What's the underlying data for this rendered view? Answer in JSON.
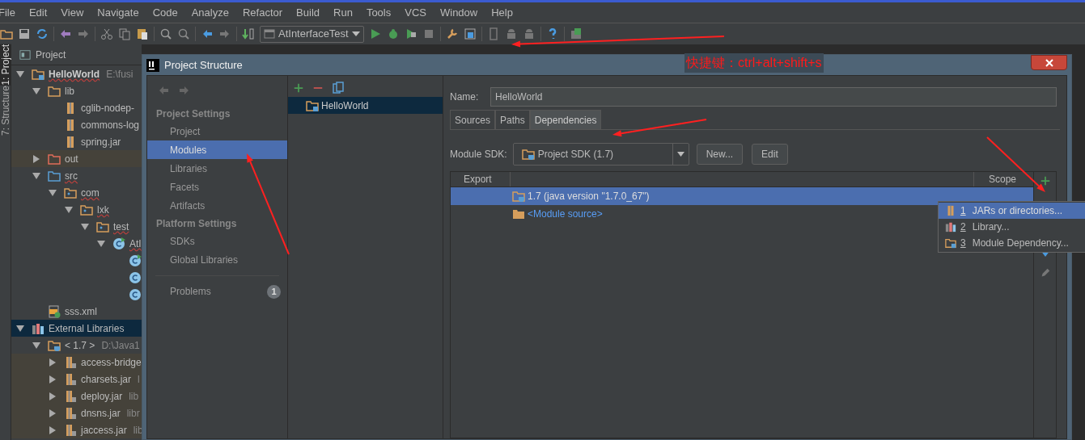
{
  "menu": [
    "File",
    "Edit",
    "View",
    "Navigate",
    "Code",
    "Analyze",
    "Refactor",
    "Build",
    "Run",
    "Tools",
    "VCS",
    "Window",
    "Help"
  ],
  "toolbar": {
    "run_config": "AtInterfaceTest"
  },
  "side_tabs": [
    {
      "label": "1: Project",
      "selected": true
    },
    {
      "label": "7: Structure",
      "selected": false
    }
  ],
  "project_panel": {
    "title": "Project",
    "tree": [
      {
        "label": "HelloWorld",
        "kind": "module",
        "hint": "E:\\fusi",
        "expanded": true,
        "typo": true,
        "children": [
          {
            "label": "lib",
            "kind": "folder",
            "expanded": true,
            "children": [
              {
                "label": "cglib-nodep-",
                "kind": "jar"
              },
              {
                "label": "commons-log",
                "kind": "jar"
              },
              {
                "label": "spring.jar",
                "kind": "jar"
              }
            ]
          },
          {
            "label": "out",
            "kind": "excluded",
            "expanded": false
          },
          {
            "label": "src",
            "kind": "source",
            "expanded": true,
            "typo": true,
            "children": [
              {
                "label": "com",
                "kind": "package",
                "expanded": true,
                "typo": true,
                "children": [
                  {
                    "label": "lxk",
                    "kind": "package",
                    "expanded": true,
                    "typo": true,
                    "children": [
                      {
                        "label": "test",
                        "kind": "package",
                        "expanded": true,
                        "typo": true,
                        "children": [
                          {
                            "label": "AtI",
                            "kind": "run-class",
                            "expanded": true,
                            "typo": true,
                            "children": [
                              {
                                "kind": "run-class"
                              },
                              {
                                "kind": "class"
                              },
                              {
                                "kind": "class"
                              }
                            ]
                          }
                        ]
                      }
                    ]
                  }
                ]
              }
            ]
          },
          {
            "label": "sss.xml",
            "kind": "xml"
          }
        ]
      },
      {
        "label": "External Libraries",
        "kind": "libraries",
        "expanded": true,
        "selected": true,
        "children": [
          {
            "label": "< 1.7 >",
            "kind": "sdk",
            "hint": "D:\\Java1",
            "expanded": true,
            "children": [
              {
                "label": "access-bridge",
                "kind": "lib-jar",
                "expanded": false
              },
              {
                "label": "charsets.jar",
                "kind": "lib-jar",
                "hint": "l",
                "expanded": false
              },
              {
                "label": "deploy.jar",
                "kind": "lib-jar",
                "hint": "lib",
                "expanded": false
              },
              {
                "label": "dnsns.jar",
                "kind": "lib-jar",
                "hint": "libr",
                "expanded": false
              },
              {
                "label": "jaccess.jar",
                "kind": "lib-jar",
                "hint": "lib",
                "expanded": false
              }
            ]
          }
        ]
      }
    ]
  },
  "dialog": {
    "title": "Project Structure",
    "nav": [
      {
        "heading": "Project Settings",
        "items": [
          {
            "label": "Project",
            "selected": false
          },
          {
            "label": "Modules",
            "selected": true
          },
          {
            "label": "Libraries",
            "selected": false
          },
          {
            "label": "Facets",
            "selected": false
          },
          {
            "label": "Artifacts",
            "selected": false
          }
        ]
      },
      {
        "heading": "Platform Settings",
        "items": [
          {
            "label": "SDKs",
            "selected": false
          },
          {
            "label": "Global Libraries",
            "selected": false
          }
        ]
      }
    ],
    "problems": {
      "label": "Problems",
      "count": "1"
    },
    "modules": [
      {
        "label": "HelloWorld",
        "selected": true
      }
    ],
    "name_label": "Name:",
    "name_value": "HelloWorld",
    "tabs": [
      {
        "label": "Sources",
        "selected": false
      },
      {
        "label": "Paths",
        "selected": false
      },
      {
        "label": "Dependencies",
        "selected": true
      }
    ],
    "sdk_label": "Module SDK:",
    "sdk_value": "Project SDK (1.7)",
    "buttons": [
      "New...",
      "Edit"
    ],
    "columns": [
      "Export",
      "Scope"
    ],
    "rows": [
      {
        "label": "1.7 (java version \"1.7.0_67\")",
        "kind": "sdk",
        "selected": true
      },
      {
        "label": "<Module source>",
        "kind": "source",
        "selected": false
      }
    ],
    "add_menu": [
      {
        "number": "1",
        "label": "JARs or directories...",
        "kind": "jar",
        "selected": true
      },
      {
        "number": "2",
        "label": "Library...",
        "kind": "library",
        "selected": false
      },
      {
        "number": "3",
        "label": "Module Dependency...",
        "kind": "module",
        "selected": false
      }
    ]
  },
  "annotation": "快捷键：ctrl+alt+shift+s"
}
